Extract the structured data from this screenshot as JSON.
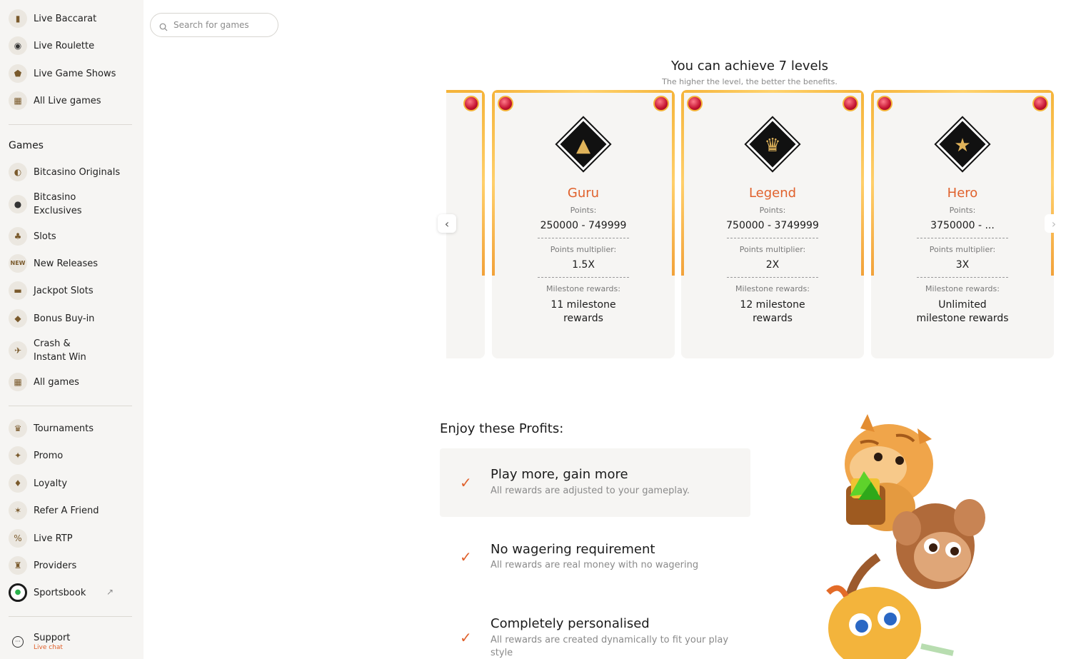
{
  "sidebar": {
    "top_items": [
      {
        "label": "Live Baccarat",
        "icon": "baccarat-icon"
      },
      {
        "label": "Live Roulette",
        "icon": "roulette-icon"
      },
      {
        "label": "Live Game Shows",
        "icon": "game-shows-icon"
      },
      {
        "label": "All Live games",
        "icon": "grid-icon"
      }
    ],
    "games_title": "Games",
    "games_items": [
      {
        "label": "Bitcasino Originals",
        "icon": "originals-icon"
      },
      {
        "label": "Bitcasino Exclusives",
        "icon": "exclusives-icon"
      },
      {
        "label": "Slots",
        "icon": "slots-icon"
      },
      {
        "label": "New Releases",
        "icon": "new-icon"
      },
      {
        "label": "Jackpot Slots",
        "icon": "jackpot-icon"
      },
      {
        "label": "Bonus Buy-in",
        "icon": "bonus-icon"
      },
      {
        "label": "Crash & Instant Win",
        "icon": "crash-icon"
      },
      {
        "label": "All games",
        "icon": "grid-icon"
      }
    ],
    "extra_items": [
      {
        "label": "Tournaments",
        "icon": "trophy-icon"
      },
      {
        "label": "Promo",
        "icon": "promo-icon"
      },
      {
        "label": "Loyalty",
        "icon": "loyalty-icon"
      },
      {
        "label": "Refer A Friend",
        "icon": "refer-icon"
      },
      {
        "label": "Live RTP",
        "icon": "rtp-icon"
      },
      {
        "label": "Providers",
        "icon": "providers-icon"
      },
      {
        "label": "Sportsbook",
        "icon": "sportsbook-icon"
      }
    ],
    "support": {
      "label": "Support",
      "sub": "Live chat"
    }
  },
  "search": {
    "placeholder": "Search for games"
  },
  "levels": {
    "title": "You can achieve 7 levels",
    "subtitle": "The higher the level, the better the benefits.",
    "points_label": "Points:",
    "multiplier_label": "Points multiplier:",
    "rewards_label": "Milestone rewards:",
    "cards": [
      {
        "name": "Guru",
        "points": "250000 - 749999",
        "multiplier": "1.5X",
        "rewards_line1": "11 milestone",
        "rewards_line2": "rewards"
      },
      {
        "name": "Legend",
        "points": "750000 - 3749999",
        "multiplier": "2X",
        "rewards_line1": "12 milestone",
        "rewards_line2": "rewards"
      },
      {
        "name": "Hero",
        "points": "3750000 - ...",
        "multiplier": "3X",
        "rewards_line1": "Unlimited",
        "rewards_line2": "milestone rewards"
      }
    ]
  },
  "profits": {
    "title": "Enjoy these Profits:",
    "items": [
      {
        "title": "Play more, gain more",
        "desc": "All rewards are adjusted to your gameplay."
      },
      {
        "title": "No wagering requirement",
        "desc": "All rewards are real money with no wagering"
      },
      {
        "title": "Completely personalised",
        "desc": "All rewards are created dynamically to fit your play style"
      }
    ]
  },
  "colors": {
    "accent": "#e0612c",
    "gold": "#f5b43a",
    "panel": "#f6f5f3"
  }
}
